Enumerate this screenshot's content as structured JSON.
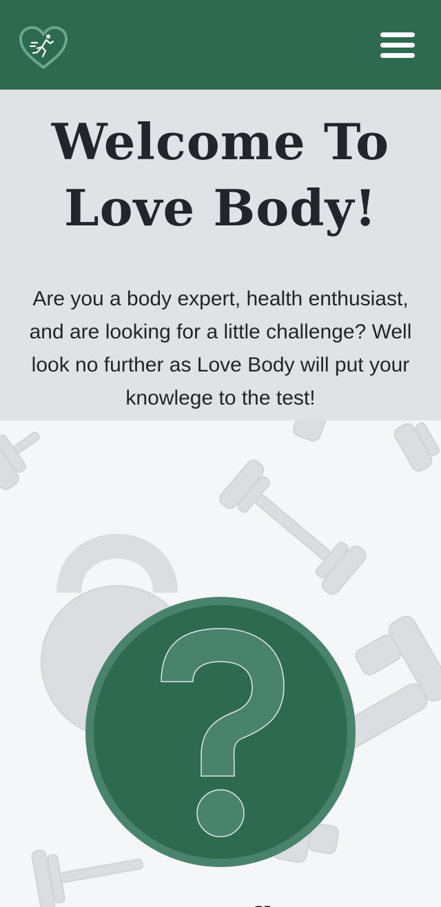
{
  "header": {
    "logo_icon": "heart-runner-logo-icon",
    "menu_icon": "hamburger-menu-icon",
    "brand_color": "#2d6a4f"
  },
  "welcome": {
    "title": "Welcome To Love Body!",
    "description": "Are you a body expert, health enthusiast, and are looking for a little challenge? Well look no further as Love Body will put your knowlege to the test!"
  },
  "quiz": {
    "icon": "question-mark-icon",
    "heading": "Test your fitness"
  },
  "colors": {
    "welcome_bg": "#e1e2e5",
    "page_bg": "#f5f6f8",
    "circle": "#2d6a4f",
    "circle_accent": "#4a836c"
  }
}
